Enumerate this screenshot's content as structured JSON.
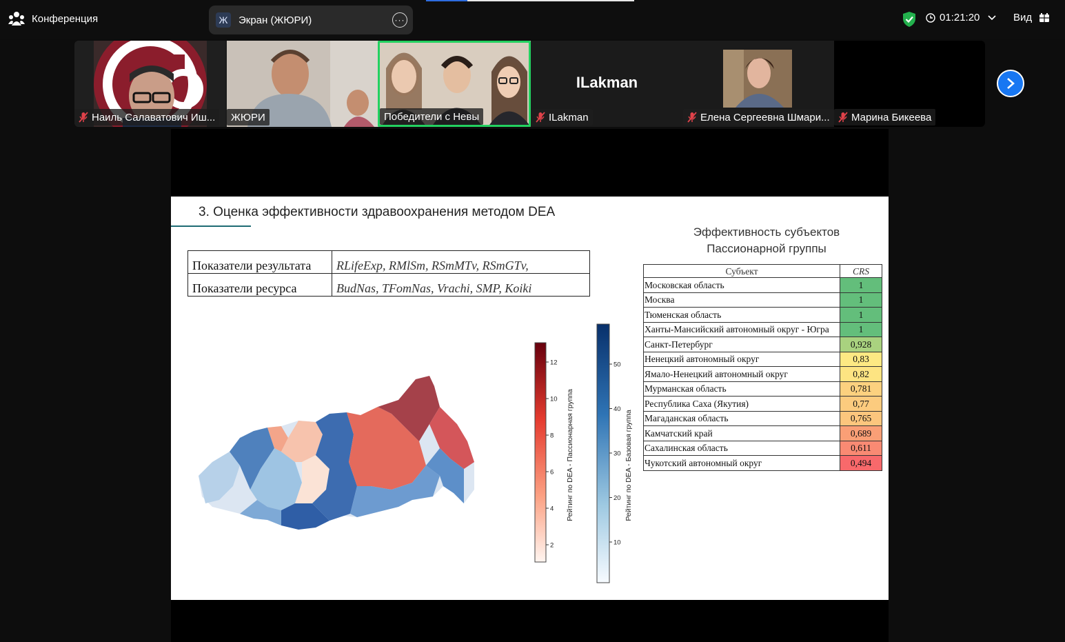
{
  "app": {
    "title": "Конференция"
  },
  "share": {
    "label": "Экран (ЖЮРИ)",
    "icon_letter": "Ж"
  },
  "meeting": {
    "timer": "01:21:20",
    "view_label": "Вид"
  },
  "participants": [
    {
      "name": "Наиль Салаватович Иш...",
      "muted": true
    },
    {
      "name": "ЖЮРИ",
      "muted": false
    },
    {
      "name": "Победители с Невы",
      "muted": false,
      "active_speaker": true
    },
    {
      "name": "ILakman",
      "muted": true,
      "avatar_text": "ILakman"
    },
    {
      "name": "Елена Сергеевна Шмари...",
      "muted": true
    },
    {
      "name": "Марина Бикеева",
      "muted": true
    }
  ],
  "slide": {
    "title": "3. Оценка эффективности здравоохранения методом DEA",
    "params": [
      {
        "label": "Показатели результата",
        "value": "RLifeExp, RMlSm, RSmMTv, RSmGTv,"
      },
      {
        "label": "Показатели ресурса",
        "value": "BudNas, TFomNas, Vrachi, SMP, Koiki"
      }
    ],
    "table_title": "Эффективность субъектов Пассионарной группы",
    "table_headers": {
      "subject": "Субъект",
      "crs": "CRS"
    },
    "rows": [
      {
        "subject": "Московская область",
        "crs": "1",
        "color": "#63be7b"
      },
      {
        "subject": "Москва",
        "crs": "1",
        "color": "#63be7b"
      },
      {
        "subject": "Тюменская область",
        "crs": "1",
        "color": "#63be7b"
      },
      {
        "subject": "Ханты-Мансийский автономный округ - Югра",
        "crs": "1",
        "color": "#63be7b"
      },
      {
        "subject": "Санкт-Петербург",
        "crs": "0,928",
        "color": "#a9d27f"
      },
      {
        "subject": "Ненецкий автономный округ",
        "crs": "0,83",
        "color": "#fde983"
      },
      {
        "subject": "Ямало-Ненецкий автономный округ",
        "crs": "0,82",
        "color": "#fde482"
      },
      {
        "subject": "Мурманская область",
        "crs": "0,781",
        "color": "#fcd17f"
      },
      {
        "subject": "Республика Саха (Якутия)",
        "crs": "0,77",
        "color": "#fccb7e"
      },
      {
        "subject": "Магаданская область",
        "crs": "0,765",
        "color": "#fcc67d"
      },
      {
        "subject": "Камчатский край",
        "crs": "0,689",
        "color": "#fa9f76"
      },
      {
        "subject": "Сахалинская область",
        "crs": "0,611",
        "color": "#f98a73"
      },
      {
        "subject": "Чукотский автономный округ",
        "crs": "0,494",
        "color": "#f8696b"
      }
    ],
    "colorbar_red": {
      "label": "Рейтинг по DEA - Пассионарная группа",
      "ticks": [
        "12",
        "10",
        "8",
        "6",
        "4",
        "2"
      ]
    },
    "colorbar_blue": {
      "label": "Рейтинг по DEA - Базовая группа",
      "ticks": [
        "50",
        "40",
        "30",
        "20",
        "10"
      ]
    }
  }
}
